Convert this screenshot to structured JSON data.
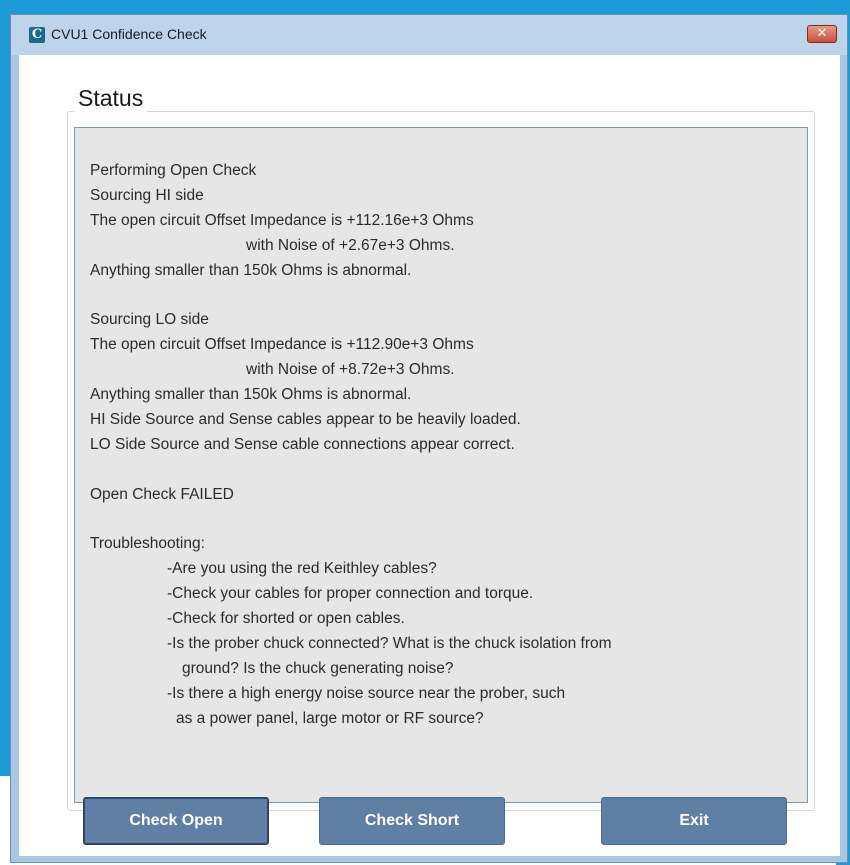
{
  "window": {
    "title": "CVU1 Confidence Check",
    "icon_glyph": "C",
    "close_glyph": "✕"
  },
  "status": {
    "title": "Status",
    "lines": [
      "Performing Open Check",
      "Sourcing HI side",
      "The open circuit Offset Impedance is +112.16e+3 Ohms",
      "with Noise of +2.67e+3 Ohms.",
      "Anything smaller than 150k Ohms is abnormal.",
      "",
      "Sourcing LO side",
      "The open circuit Offset Impedance is +112.90e+3 Ohms",
      "with Noise of +8.72e+3 Ohms.",
      "Anything smaller than 150k Ohms is abnormal.",
      "HI Side Source and Sense cables appear to be heavily loaded.",
      "LO Side Source and Sense cable connections appear correct.",
      "",
      "Open Check FAILED",
      "",
      "Troubleshooting:",
      "-Are you using the red Keithley cables?",
      "-Check your cables for proper connection and torque.",
      "-Check for shorted or open cables.",
      "-Is the prober chuck connected?  What is the chuck isolation from",
      "ground? Is the chuck generating noise?",
      "-Is there a high energy noise source near the prober, such",
      "as a power panel, large motor or RF source?"
    ]
  },
  "buttons": {
    "check_open": "Check Open",
    "check_short": "Check Short",
    "exit": "Exit"
  }
}
